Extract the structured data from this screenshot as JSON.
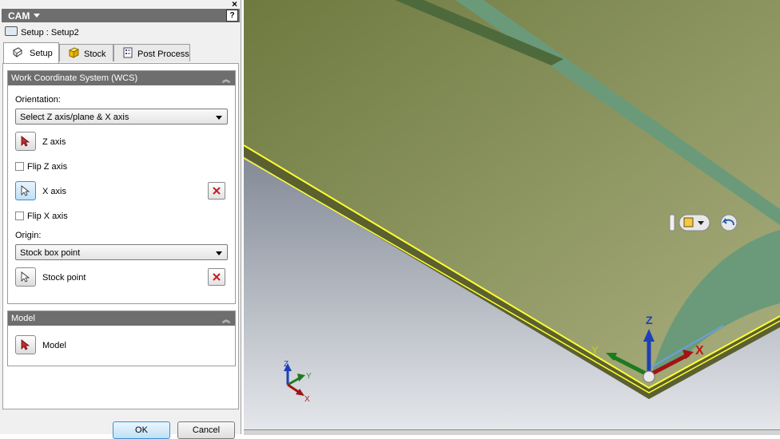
{
  "panel": {
    "title": "CAM",
    "help_label": "?",
    "close_label": "×",
    "setup_path": "Setup : Setup2",
    "tabs": [
      {
        "label": "Setup"
      },
      {
        "label": "Stock"
      },
      {
        "label": "Post Process"
      }
    ],
    "wcs": {
      "header": "Work Coordinate System (WCS)",
      "orientation_label": "Orientation:",
      "orientation_value": "Select Z axis/plane & X axis",
      "z_axis_label": "Z axis",
      "flip_z_label": "Flip Z axis",
      "flip_z_checked": false,
      "x_axis_label": "X axis",
      "flip_x_label": "Flip X axis",
      "flip_x_checked": false,
      "origin_label": "Origin:",
      "origin_value": "Stock box point",
      "stock_point_label": "Stock point"
    },
    "model": {
      "header": "Model",
      "model_label": "Model"
    },
    "ok_label": "OK",
    "cancel_label": "Cancel"
  },
  "viewport": {
    "triad_small": {
      "z": "Z",
      "y": "Y",
      "x": "X"
    },
    "triad_main": {
      "z": "Z",
      "y": "Y",
      "x": "X"
    },
    "colors": {
      "x_axis": "#a01414",
      "y_axis": "#1f7a1f",
      "z_axis": "#1f3fb8",
      "stock_outline": "#ffff33",
      "part_top": "#8e9a62",
      "rail": "#6a9a7a"
    }
  }
}
